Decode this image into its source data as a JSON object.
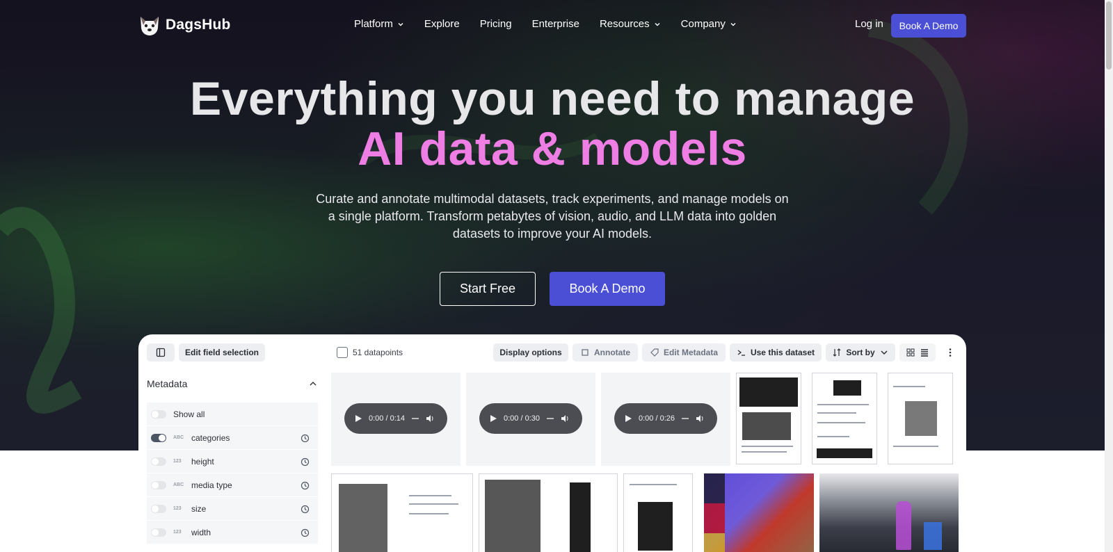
{
  "brand": {
    "name": "DagsHub"
  },
  "nav": {
    "items": [
      {
        "label": "Platform",
        "dropdown": true
      },
      {
        "label": "Explore",
        "dropdown": false
      },
      {
        "label": "Pricing",
        "dropdown": false
      },
      {
        "label": "Enterprise",
        "dropdown": false
      },
      {
        "label": "Resources",
        "dropdown": true
      },
      {
        "label": "Company",
        "dropdown": true
      }
    ],
    "login": "Log in",
    "cta": "Book A Demo"
  },
  "hero": {
    "title_line1": "Everything you need to manage",
    "title_line2": "AI data & models",
    "subtitle": "Curate and annotate multimodal datasets, track experiments, and manage models on a single platform. Transform petabytes of vision, audio, and LLM data into golden datasets to improve your AI models.",
    "primary_cta": "Start Free",
    "secondary_cta": "Book A Demo"
  },
  "app": {
    "toolbar": {
      "edit_fields": "Edit field selection",
      "datapoints": "51 datapoints",
      "display_options": "Display options",
      "annotate": "Annotate",
      "edit_metadata": "Edit Metadata",
      "use_dataset": "Use this dataset",
      "sort_by": "Sort by"
    },
    "sidebar": {
      "title": "Metadata",
      "rows": [
        {
          "label": "Show all",
          "type": "",
          "on": false
        },
        {
          "label": "categories",
          "type": "ABC",
          "on": true
        },
        {
          "label": "height",
          "type": "123",
          "on": false
        },
        {
          "label": "media type",
          "type": "ABC",
          "on": false
        },
        {
          "label": "size",
          "type": "123",
          "on": false
        },
        {
          "label": "width",
          "type": "123",
          "on": false
        }
      ]
    },
    "audio_players": [
      {
        "time": "0:00 / 0:14"
      },
      {
        "time": "0:00 / 0:30"
      },
      {
        "time": "0:00 / 0:26"
      }
    ]
  },
  "colors": {
    "accent": "#4a4fd6",
    "headline_pink": "#ef7ee4",
    "hero_bg": "#1b1a2a"
  }
}
